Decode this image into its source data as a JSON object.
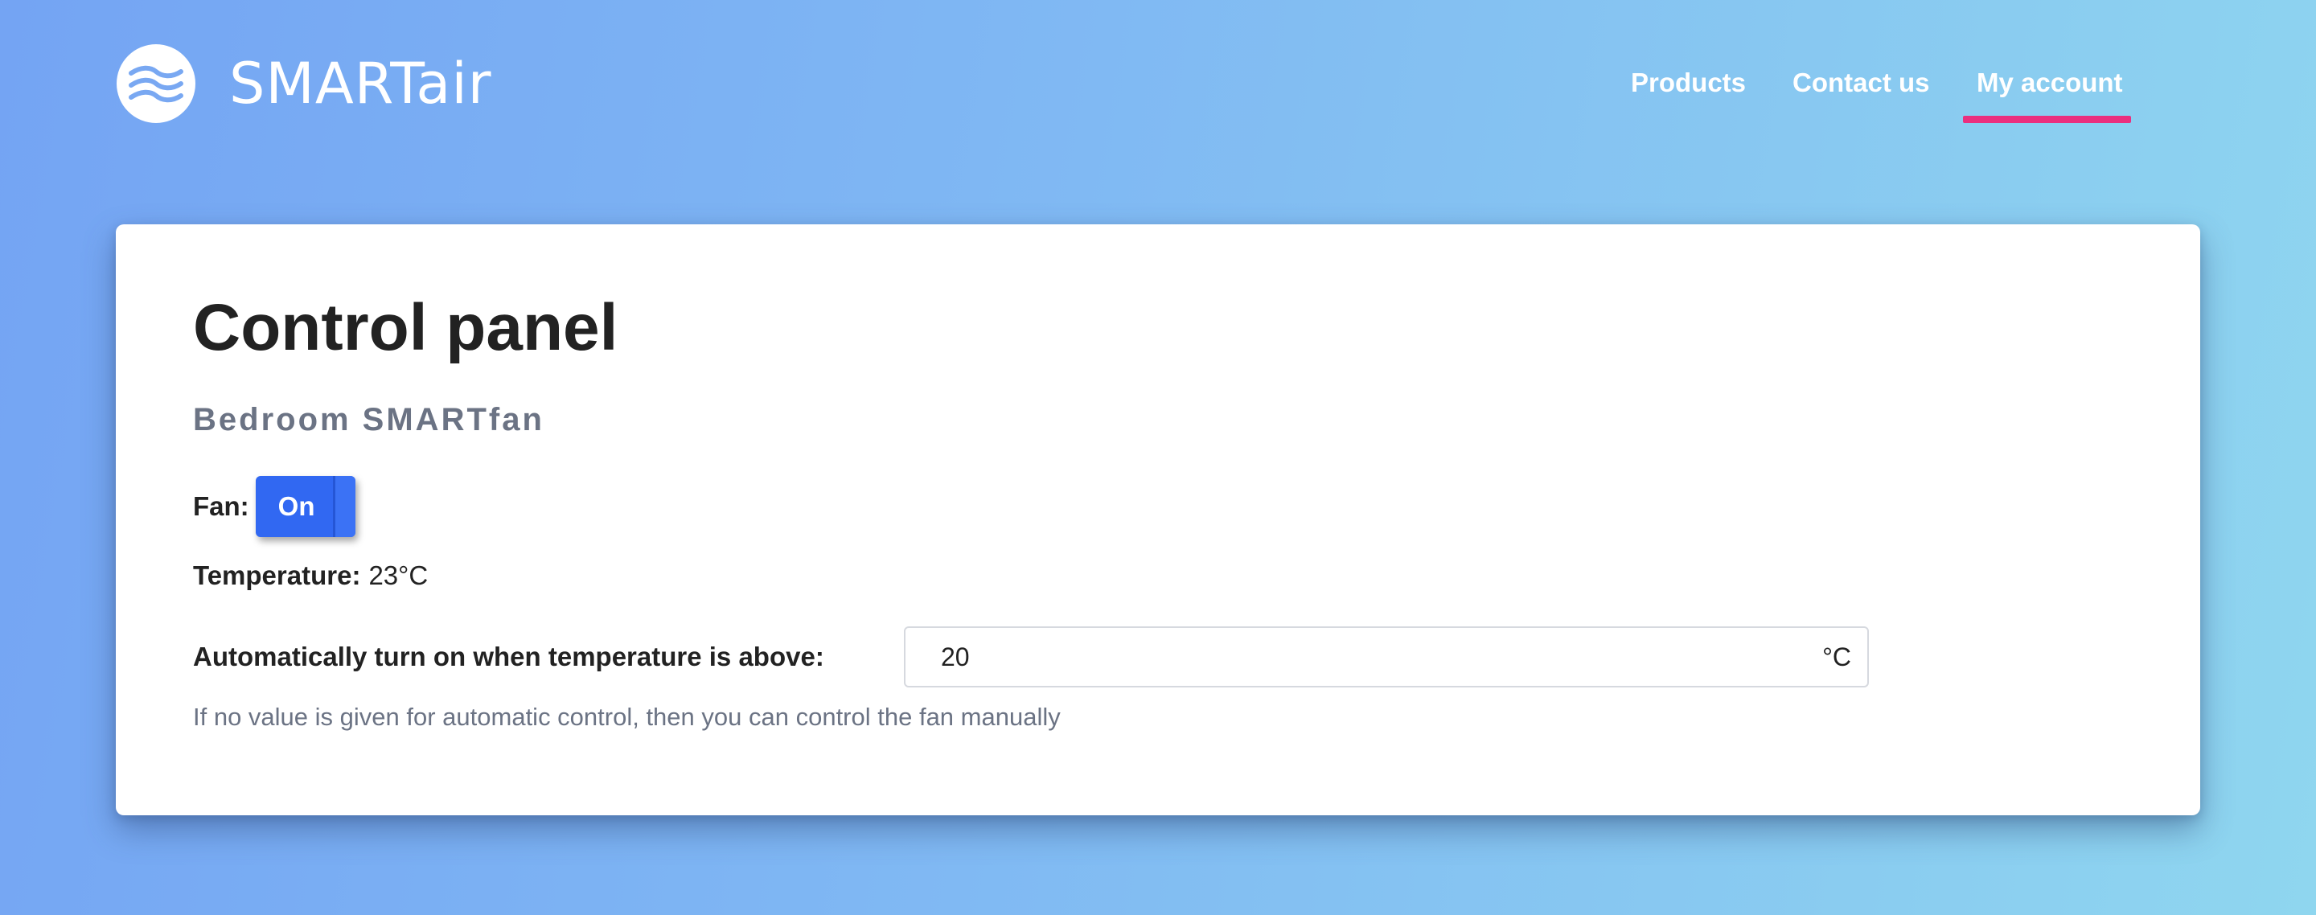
{
  "header": {
    "logo_text": "SMARTair",
    "logo_icon": "waves-icon",
    "nav": [
      {
        "label": "Products"
      },
      {
        "label": "Contact us"
      },
      {
        "label": "My account",
        "active": true
      }
    ]
  },
  "main": {
    "title": "Control panel",
    "device_name": "Bedroom SMARTfan",
    "fan": {
      "label": "Fan:",
      "toggle_label": "On",
      "state": "on"
    },
    "temperature": {
      "label": "Temperature:",
      "value": "23°C"
    },
    "auto_control": {
      "label": "Automatically turn on when temperature is above:",
      "value": "20",
      "unit": "°C",
      "help": "If no value is given for automatic control, then you can control the fan manually"
    }
  },
  "colors": {
    "accent_underline": "#ea2f7e",
    "toggle_on": "#3168f2",
    "background_start": "#74a4f3",
    "background_end": "#8fd6ef"
  }
}
